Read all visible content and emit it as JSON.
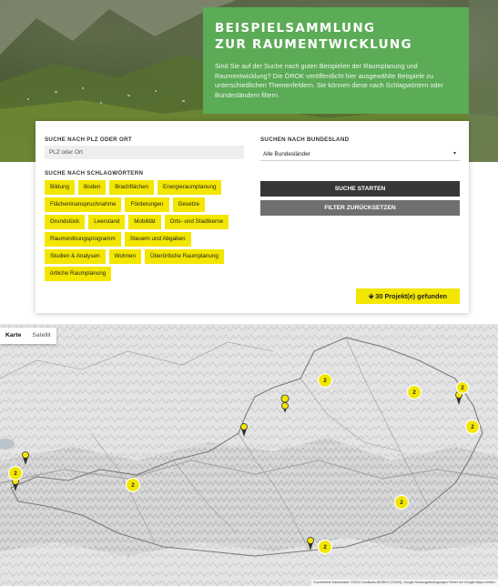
{
  "hero": {
    "title_line1": "BEISPIELSAMMLUNG",
    "title_line2": "ZUR RAUMENTWICKLUNG",
    "description": "Sind Sie auf der Suche nach guten Beispielen der Raumplanung und Raumentwicklung?  Die ÖROK veröffentlicht hier ausgewählte Beispiele zu unterschiedlichen Themenfeldern. Sie können diese nach Schlagwörtern oder Bundesländern filtern."
  },
  "search": {
    "plz_label": "SUCHE NACH PLZ ODER ORT",
    "plz_placeholder": "PLZ oder Ort",
    "state_label": "SUCHEN NACH BUNDESLAND",
    "state_value": "Alle Bundesländer",
    "tags_label": "SUCHE NACH SCHLAGWÖRTERN",
    "tags": [
      "Bildung",
      "Boden",
      "Brachflächen",
      "Energieraumplanung",
      "Flächeninanspruchnahme",
      "Förderungen",
      "Gesetze",
      "Grundstück",
      "Leerstand",
      "Mobilität",
      "Orts- und Stadtkerne",
      "Raumordnungsprogramm",
      "Steuern und Abgaben",
      "Studien & Analysen",
      "Wohnen",
      "Überörtliche Raumplanung",
      "örtliche Raumplanung"
    ],
    "start_button": "SUCHE STARTEN",
    "reset_button": "FILTER ZURÜCKSETZEN",
    "results": "30 Projekt(e) gefunden"
  },
  "map": {
    "type_map": "Karte",
    "type_satellite": "Satellit",
    "attribution": "Kurzbefehle   Kartendaten ©2024 GeoBasis-DE/BKG (©2009), Google   Nutzungsbedingungen   Fehler bei Google Maps melden",
    "clusters": [
      "2",
      "2",
      "2",
      "2",
      "2",
      "2",
      "2",
      "2"
    ]
  },
  "colors": {
    "accent_yellow": "#f3e600",
    "hero_green": "#5cab57",
    "button_dark": "#363636",
    "button_grey": "#6f6f6f"
  }
}
